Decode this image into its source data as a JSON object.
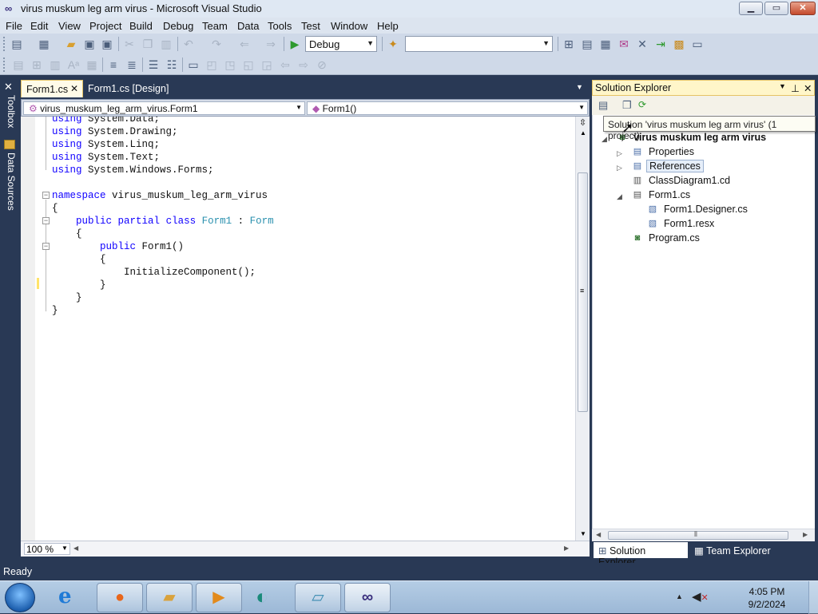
{
  "window": {
    "title": "virus muskum leg arm virus - Microsoft Visual Studio",
    "minimize": "▁",
    "maximize": "▭",
    "close": "✕"
  },
  "menu": [
    "File",
    "Edit",
    "View",
    "Project",
    "Build",
    "Debug",
    "Team",
    "Data",
    "Tools",
    "Test",
    "Window",
    "Help"
  ],
  "toolbar": {
    "config": "Debug",
    "platform": ""
  },
  "side_tabs": {
    "toolbox": "Toolbox",
    "data_sources": "Data Sources"
  },
  "editor": {
    "tabs": [
      {
        "label": "Form1.cs",
        "active": true
      },
      {
        "label": "Form1.cs [Design]",
        "active": false
      }
    ],
    "nav_left": "virus_muskum_leg_arm_virus.Form1",
    "nav_right": "Form1()",
    "zoom": "100 %",
    "lines": [
      "using System.Data;",
      "using System.Drawing;",
      "using System.Linq;",
      "using System.Text;",
      "using System.Windows.Forms;",
      "",
      "namespace virus_muskum_leg_arm_virus",
      "{",
      "    public partial class Form1 : Form",
      "    {",
      "        public Form1()",
      "        {",
      "            InitializeComponent();",
      "        }",
      "    }",
      "}"
    ]
  },
  "solution_explorer": {
    "title": "Solution Explorer",
    "tooltip": "Solution 'virus muskum leg arm virus' (1 project)",
    "project": "virus muskum leg arm virus",
    "items": [
      "Properties",
      "References",
      "ClassDiagram1.cd",
      "Form1.cs",
      "Form1.Designer.cs",
      "Form1.resx",
      "Program.cs"
    ],
    "bottom_tabs": [
      "Solution Explorer",
      "Team Explorer"
    ]
  },
  "status": "Ready",
  "clock": {
    "time": "4:05 PM",
    "date": "9/2/2024"
  },
  "colors": {
    "keyword": "#1000ff",
    "type": "#2b91af",
    "chrome": "#293955",
    "active_tab": "#fffbe8"
  }
}
